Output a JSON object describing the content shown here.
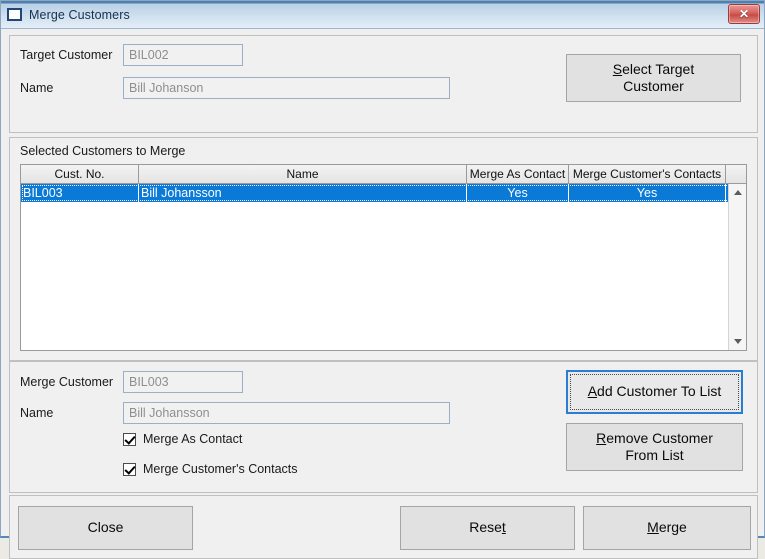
{
  "window": {
    "title": "Merge Customers",
    "icon": "window-icon",
    "close_label": "✕"
  },
  "target_panel": {
    "customer_label": "Target Customer",
    "customer_value": "BIL002",
    "name_label": "Name",
    "name_value": "Bill Johanson",
    "select_button": {
      "accel": "S",
      "rest_line1": "elect Target",
      "line2": "Customer"
    }
  },
  "merge_panel": {
    "caption": "Selected Customers to Merge",
    "columns": [
      "Cust. No.",
      "Name",
      "Merge As Contact",
      "Merge Customer's Contacts",
      ""
    ],
    "rows": [
      {
        "cust_no": "BIL003",
        "name": "Bill Johansson",
        "merge_as_contact": "Yes",
        "merge_customers_contacts": "Yes",
        "extra": ""
      }
    ],
    "scrollbar": {
      "up_icon": "chevron-up-icon",
      "down_icon": "chevron-down-icon"
    }
  },
  "detail_panel": {
    "customer_label": "Merge Customer",
    "customer_value": "BIL003",
    "name_label": "Name",
    "name_value": "Bill Johansson",
    "checkbox_merge_as_contact": {
      "label": "Merge As Contact",
      "checked": true
    },
    "checkbox_merge_contacts": {
      "label": "Merge Customer's Contacts",
      "checked": true
    },
    "add_button": {
      "accel": "A",
      "rest": "dd Customer To List",
      "focused": true
    },
    "remove_button": {
      "accel": "R",
      "rest_line1": "emove Customer",
      "line2": "From List"
    }
  },
  "action_panel": {
    "close_button": "Close",
    "reset_button": {
      "pre": "Rese",
      "accel": "t",
      "post": ""
    },
    "merge_button": {
      "accel": "M",
      "rest": "erge"
    }
  },
  "colors": {
    "selection_blue": "#0a7ad6",
    "focus_blue": "#2b7cd3",
    "close_red": "#c94a44",
    "panel_bg": "#f0f0f0",
    "field_text": "#8e8e8e"
  }
}
